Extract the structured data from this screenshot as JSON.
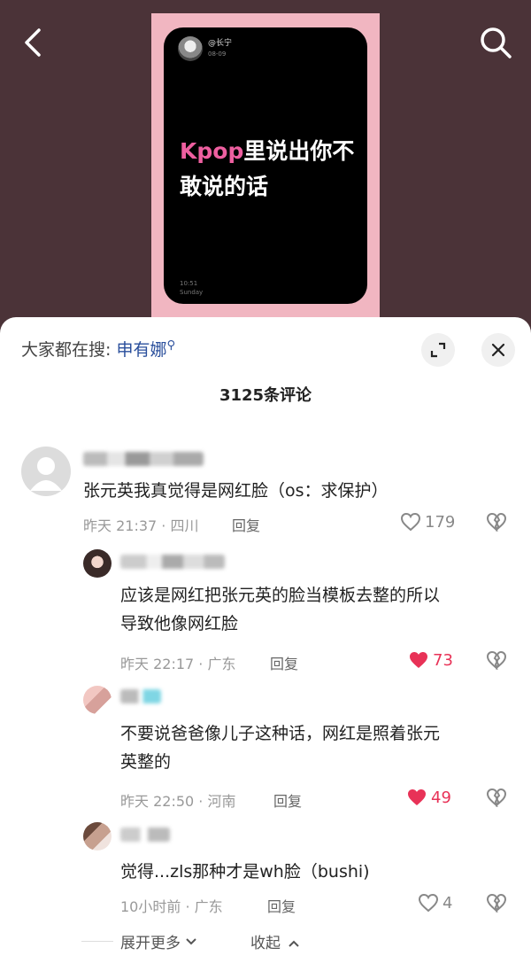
{
  "video": {
    "card_user": "@长宁",
    "card_date": "08-09",
    "card_title_highlight": "Kpop",
    "card_title_rest": "里说出你不敢说的话",
    "card_time": "10:51",
    "card_day": "Sunday"
  },
  "sheet": {
    "trending_prefix": "大家都在搜:",
    "trending_keyword": "申有娜",
    "comment_count": "3125条评论",
    "expand_more": "展开更多",
    "collapse": "收起"
  },
  "comments": [
    {
      "text": "张元英我真觉得是网红脸（os：求保护）",
      "meta": "昨天 21:37 · 四川",
      "reply": "回复",
      "likes": "179",
      "liked": false
    }
  ],
  "replies": [
    {
      "text_line1": "应该是网红把张元英的脸当模板去整的所以",
      "text_line2": "导致他像网红脸",
      "meta": "昨天 22:17 · 广东",
      "reply": "回复",
      "likes": "73",
      "liked": true
    },
    {
      "text_line1": "不要说爸爸像儿子这种话，网红是照着张元",
      "text_line2": "英整的",
      "meta": "昨天 22:50 · 河南",
      "reply": "回复",
      "likes": "49",
      "liked": true
    },
    {
      "text_line1": "觉得...zls那种才是wh脸（bushi)",
      "meta": "10小时前 · 广东",
      "reply": "回复",
      "likes": "4",
      "liked": false
    }
  ],
  "colors": {
    "accent_red": "#e83257",
    "keyword_blue": "#2a4f9c",
    "highlight_pink": "#ee5fa0"
  }
}
